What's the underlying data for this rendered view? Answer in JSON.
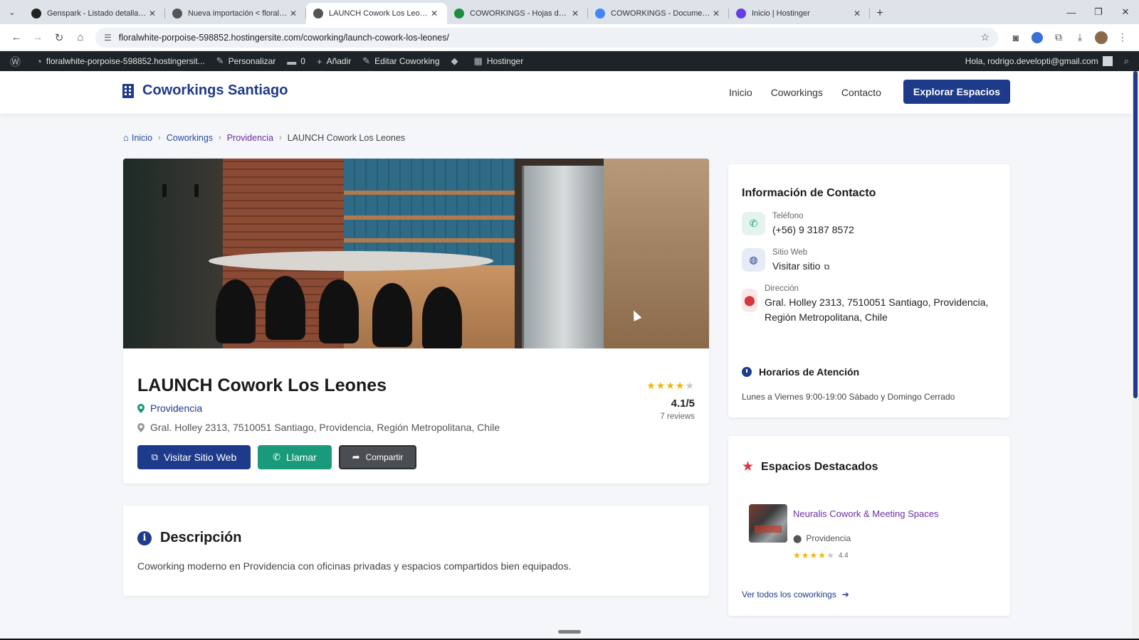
{
  "browser": {
    "tabs": [
      {
        "title": "Genspark - Listado detallado d",
        "color": "#222222",
        "active": false
      },
      {
        "title": "Nueva importación < floralwhit",
        "color": "#555555",
        "active": false
      },
      {
        "title": "LAUNCH Cowork Los Leones –",
        "color": "#555555",
        "active": true
      },
      {
        "title": "COWORKINGS - Hojas de cálcu",
        "color": "#1e8e3e",
        "active": false
      },
      {
        "title": "COWORKINGS - Documentos d",
        "color": "#4285f4",
        "active": false
      },
      {
        "title": "Inicio | Hostinger",
        "color": "#673de6",
        "active": false
      }
    ],
    "url": "floralwhite-porpoise-598852.hostingersite.com/coworking/launch-cowork-los-leones/"
  },
  "adminbar": {
    "site": "floralwhite-porpoise-598852.hostingersit...",
    "customize": "Personalizar",
    "comments": "0",
    "add": "Añadir",
    "edit": "Editar Coworking",
    "hostinger": "Hostinger",
    "greeting": "Hola, rodrigo.developti@gmail.com"
  },
  "header": {
    "brand": "Coworkings Santiago",
    "nav": [
      "Inicio",
      "Coworkings",
      "Contacto"
    ],
    "cta": "Explorar Espacios"
  },
  "breadcrumb": {
    "home": "Inicio",
    "coworkings": "Coworkings",
    "district": "Providencia",
    "current": "LAUNCH Cowork Los Leones"
  },
  "listing": {
    "title": "LAUNCH Cowork Los Leones",
    "district": "Providencia",
    "address": "Gral. Holley 2313, 7510051 Santiago, Providencia, Región Metropolitana, Chile",
    "rating_stars": 4,
    "rating_text": "4.1/5",
    "reviews": "7 reviews",
    "buttons": {
      "website": "Visitar Sitio Web",
      "call": "Llamar",
      "share": "Compartir"
    }
  },
  "description": {
    "title": "Descripción",
    "text": "Coworking moderno en Providencia con oficinas privadas y espacios compartidos bien equipados."
  },
  "contact": {
    "title": "Información de Contacto",
    "phone_label": "Teléfono",
    "phone": "(+56) 9 3187 8572",
    "web_label": "Sitio Web",
    "web": "Visitar sitio",
    "address_label": "Dirección",
    "address_line1": "Gral. Holley 2313, 7510051 Santiago, Providencia,",
    "address_line2": "Región Metropolitana, Chile",
    "hours_title": "Horarios de Atención",
    "hours": "Lunes a Viernes 9:00-19:00 Sábado y Domingo Cerrado"
  },
  "featured": {
    "title": "Espacios Destacados",
    "item_name": "Neuralis Cowork & Meeting Spaces",
    "item_location": "Providencia",
    "item_stars": 4,
    "item_rating": "4.4",
    "see_all": "Ver todos los coworkings"
  }
}
